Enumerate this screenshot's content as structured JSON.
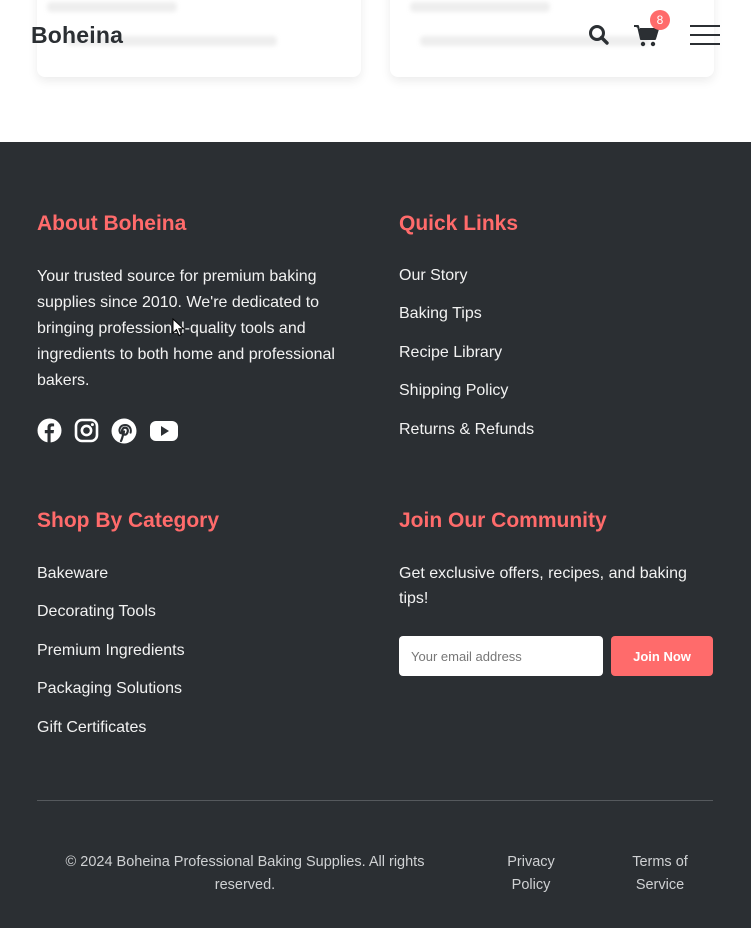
{
  "header": {
    "brand": "Boheina",
    "cart_count": "8",
    "icons": {
      "search": "search-icon",
      "cart": "cart-icon",
      "menu": "hamburger-menu-icon"
    }
  },
  "about": {
    "title": "About Boheina",
    "text": "Your trusted source for premium baking supplies since 2010. We're dedicated to bringing professional-quality tools and ingredients to both home and professional bakers.",
    "social_icons": [
      "facebook-icon",
      "instagram-icon",
      "pinterest-icon",
      "youtube-icon"
    ]
  },
  "quick_links": {
    "title": "Quick Links",
    "items": [
      "Our Story",
      "Baking Tips",
      "Recipe Library",
      "Shipping Policy",
      "Returns & Refunds"
    ]
  },
  "categories": {
    "title": "Shop By Category",
    "items": [
      "Bakeware",
      "Decorating Tools",
      "Premium Ingredients",
      "Packaging Solutions",
      "Gift Certificates"
    ]
  },
  "community": {
    "title": "Join Our Community",
    "text": "Get exclusive offers, recipes, and baking tips!",
    "email_placeholder": "Your email address",
    "button": "Join Now"
  },
  "bottom": {
    "copyright": "© 2024 Boheina Professional Baking Supplies. All rights reserved.",
    "privacy": "Privacy Policy",
    "terms": "Terms of Service"
  },
  "colors": {
    "accent": "#ff6b6b",
    "footer_bg": "#2b2f33",
    "text": "#f2f2f2"
  }
}
